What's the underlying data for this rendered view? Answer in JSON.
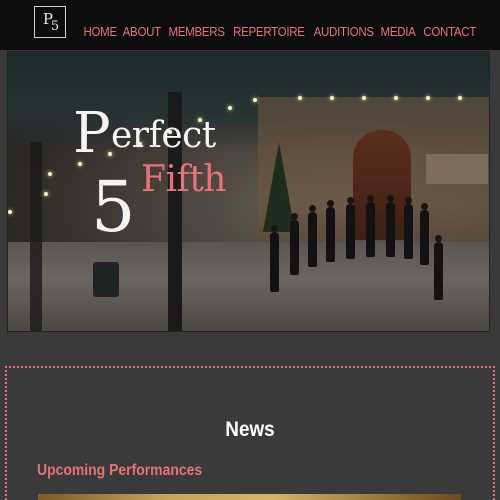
{
  "header": {
    "logo_text": "P5",
    "nav": [
      {
        "label": "HOME"
      },
      {
        "label": "ABOUT"
      },
      {
        "label": "MEMBERS"
      },
      {
        "label": "REPERTOIRE"
      },
      {
        "label": "AUDITIONS"
      },
      {
        "label": "MEDIA"
      },
      {
        "label": "CONTACT"
      }
    ]
  },
  "hero": {
    "brand_line1": "erfect",
    "brand_line2": "Fifth",
    "brand_initial": "P",
    "brand_number": "5",
    "image_description": "choir-performance-photo"
  },
  "content": {
    "section_title": "News",
    "subsection_title": "Upcoming Performances"
  },
  "colors": {
    "accent": "#e8727a",
    "nav_background": "#0d0d0d",
    "page_background": "#3a3a3a"
  }
}
